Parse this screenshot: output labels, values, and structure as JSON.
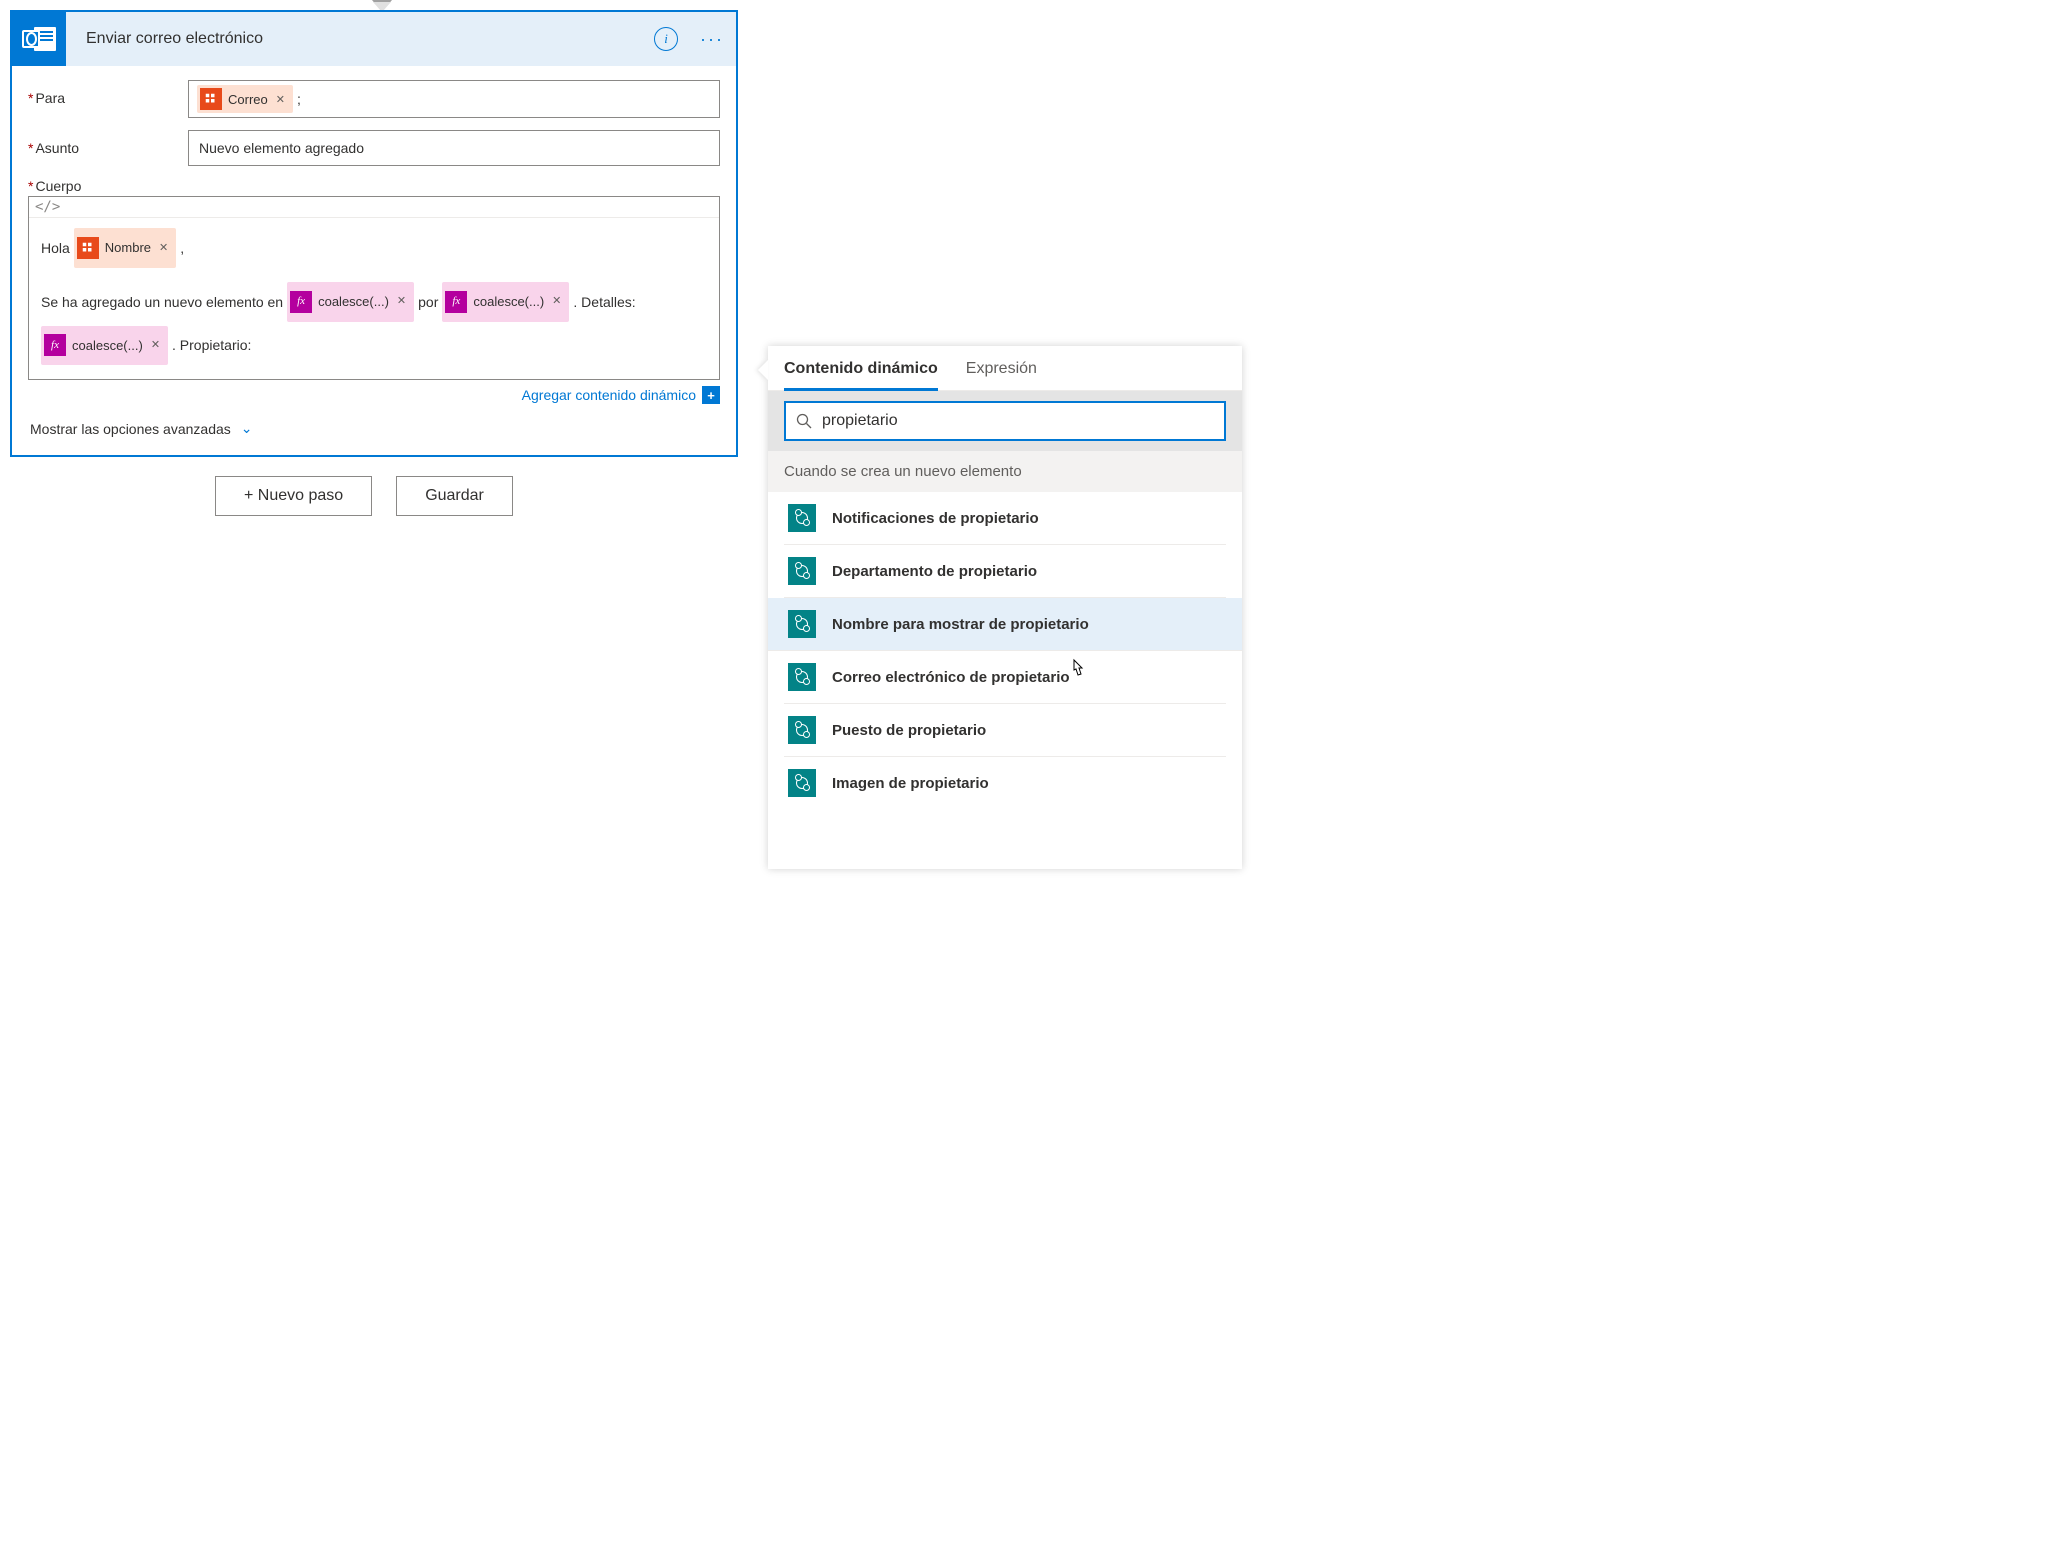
{
  "card": {
    "title": "Enviar correo electrónico",
    "fields": {
      "to_label": "Para",
      "subject_label": "Asunto",
      "subject_value": "Nuevo elemento agregado",
      "body_label": "Cuerpo"
    },
    "tokens": {
      "correo": "Correo",
      "nombre": "Nombre",
      "coalesce": "coalesce(...)"
    },
    "body_text": {
      "hola": "Hola",
      "comma": ",",
      "line2_a": "Se ha agregado un nuevo elemento en",
      "por": "por",
      "detalles": ". Detalles:",
      "propietario": ". Propietario:"
    },
    "add_dynamic": "Agregar contenido dinámico",
    "advanced": "Mostrar las opciones avanzadas"
  },
  "buttons": {
    "new_step": "+ Nuevo paso",
    "save": "Guardar"
  },
  "panel": {
    "tab_dynamic": "Contenido dinámico",
    "tab_expression": "Expresión",
    "search_value": "propietario",
    "group_header": "Cuando se crea un nuevo elemento",
    "items": [
      "Notificaciones de propietario",
      "Departamento de propietario",
      "Nombre para mostrar de propietario",
      "Correo electrónico de propietario",
      "Puesto de propietario",
      "Imagen de propietario"
    ]
  }
}
